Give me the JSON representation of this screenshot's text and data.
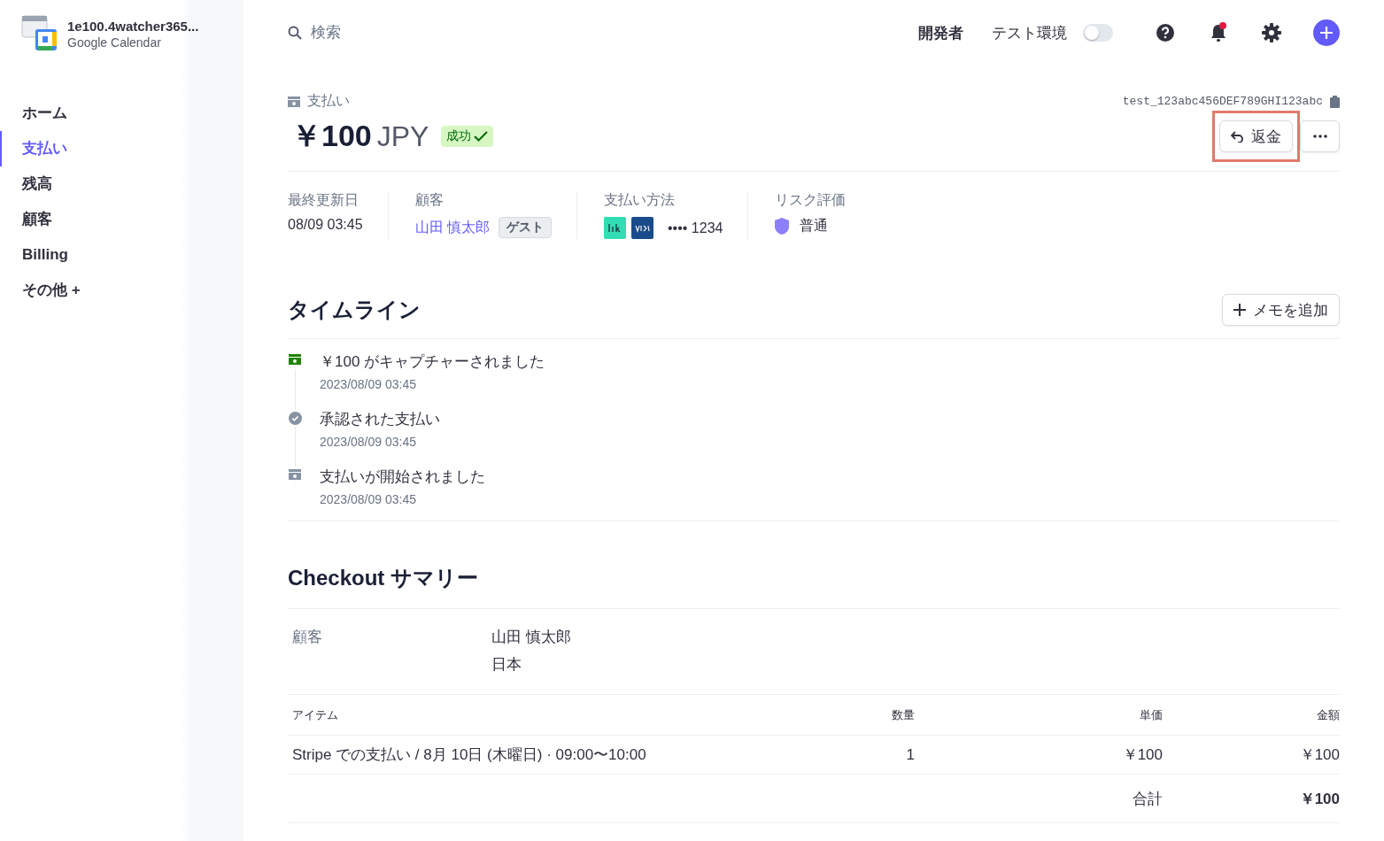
{
  "account": {
    "name": "1e100.4watcher365...",
    "subtitle": "Google Calendar"
  },
  "sidebar": {
    "items": [
      {
        "label": "ホーム",
        "selected": false
      },
      {
        "label": "支払い",
        "selected": true
      },
      {
        "label": "残高",
        "selected": false
      },
      {
        "label": "顧客",
        "selected": false
      },
      {
        "label": "Billing",
        "selected": false
      },
      {
        "label": "その他 +",
        "selected": false
      }
    ]
  },
  "topbar": {
    "search_placeholder": "検索",
    "developer": "開発者",
    "test_mode": {
      "label": "テスト環境",
      "on": false
    },
    "notifications_unread": true
  },
  "payment": {
    "breadcrumb": "支払い",
    "id": "test_123abc456DEF789GHI123abc",
    "amount": "￥100",
    "currency": "JPY",
    "status": "成功",
    "refund_button": {
      "label": "返金",
      "highlighted": true
    },
    "details": [
      {
        "kind": "text",
        "label": "最終更新日",
        "value": "08/09 03:45"
      },
      {
        "kind": "customer",
        "label": "顧客",
        "value": "山田 慎太郎",
        "tag": "ゲスト"
      },
      {
        "kind": "card",
        "label": "支払い方法",
        "value": "•••• 1234"
      },
      {
        "kind": "risk",
        "label": "リスク評価",
        "value": "普通"
      }
    ]
  },
  "timeline": {
    "title": "タイムライン",
    "add_note": "メモを追加",
    "events": [
      {
        "kind": "captured",
        "text": "￥100 がキャプチャーされました",
        "time": "2023/08/09 03:45"
      },
      {
        "kind": "approved",
        "text": "承認された支払い",
        "time": "2023/08/09 03:45"
      },
      {
        "kind": "started",
        "text": "支払いが開始されました",
        "time": "2023/08/09 03:45"
      }
    ]
  },
  "checkout": {
    "title": "Checkout サマリー",
    "customer_label": "顧客",
    "customer_name": "山田 慎太郎",
    "customer_country": "日本",
    "columns": [
      "アイテム",
      "数量",
      "単価",
      "金額"
    ],
    "rows": [
      [
        "Stripe での支払い / 8月 10日 (木曜日) · 09:00〜10:00",
        "1",
        "￥100",
        "￥100"
      ]
    ],
    "total_label": "合計",
    "total": "￥100"
  }
}
